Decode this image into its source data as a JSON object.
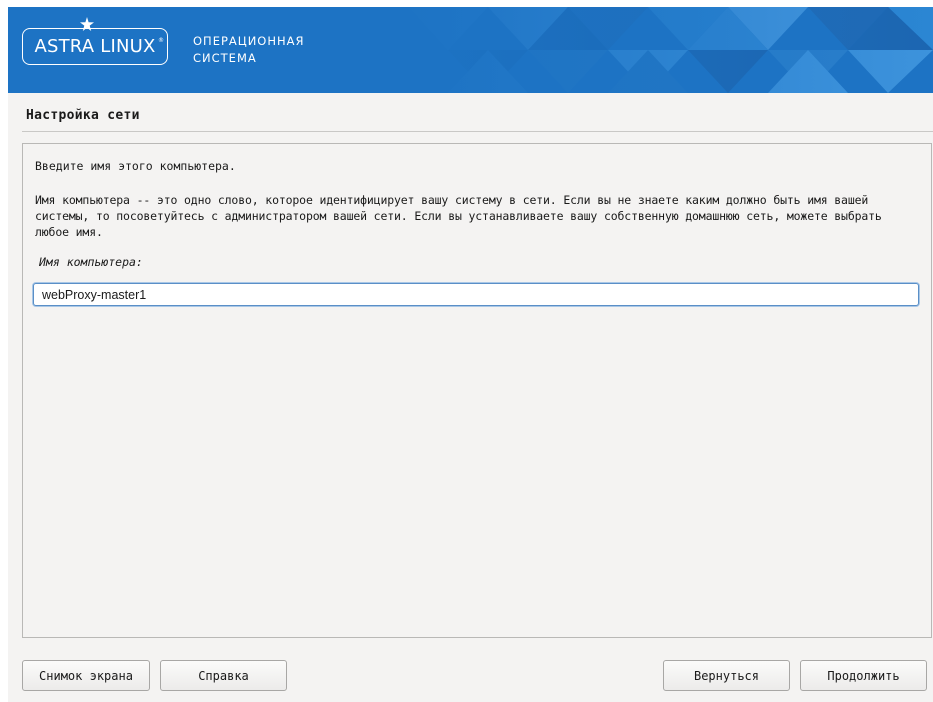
{
  "header": {
    "logo_text": "ASTRA LINUX",
    "logo_reg": "®",
    "tagline_line1": "ОПЕРАЦИОННАЯ",
    "tagline_line2": "СИСТЕМА",
    "brand_color": "#1d73c4"
  },
  "section": {
    "title": "Настройка сети"
  },
  "panel": {
    "prompt": "Введите имя этого компьютера.",
    "description": "Имя компьютера -- это одно слово, которое идентифицирует вашу систему в сети. Если вы не знаете каким должно быть имя вашей системы, то посоветуйтесь с администратором вашей сети. Если вы устанавливаете вашу собственную домашнюю сеть, можете выбрать любое имя.",
    "field_label": "Имя компьютера:",
    "hostname_value": "webProxy-master1"
  },
  "buttons": {
    "screenshot": "Снимок экрана",
    "help": "Справка",
    "back": "Вернуться",
    "continue": "Продолжить"
  }
}
